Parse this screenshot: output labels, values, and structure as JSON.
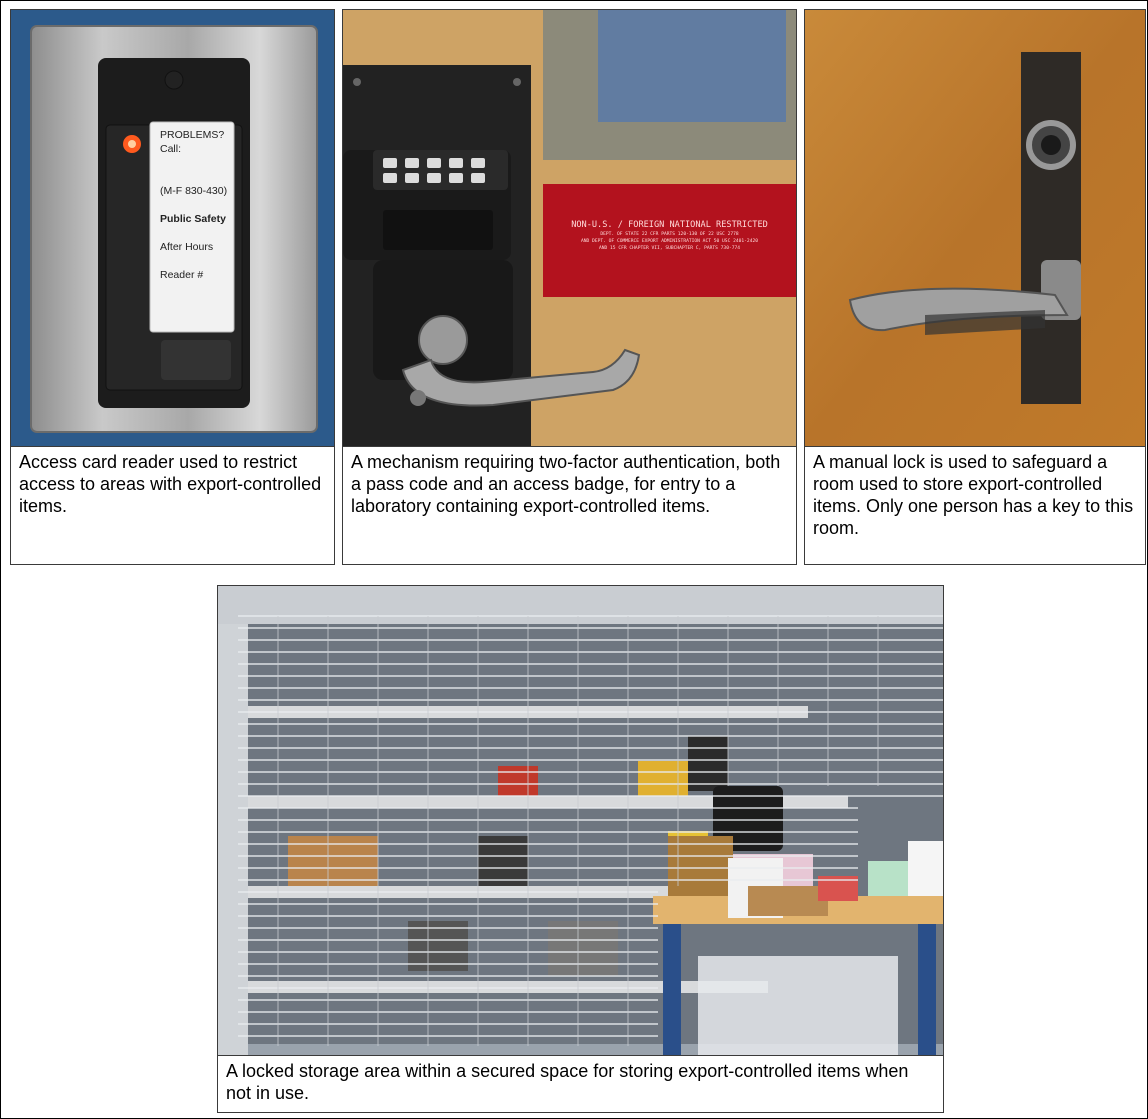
{
  "panels": [
    {
      "caption": "Access card reader used to restrict access to areas with export-controlled items.",
      "sticker": {
        "line1": "PROBLEMS?",
        "line2": "Call:",
        "hours": "(M-F 830-430)",
        "dept": "Public Safety",
        "after": "After Hours",
        "reader": "Reader #"
      }
    },
    {
      "caption": "A mechanism requiring two-factor authentication, both a pass code and an access badge, for entry to a laboratory containing export-controlled items.",
      "sign": {
        "title": "NON-U.S. / FOREIGN NATIONAL RESTRICTED",
        "line1": "DEPT. OF STATE 22 CFR PARTS 120-130 OF 22 USC 2778",
        "line2": "AND DEPT. OF COMMERCE EXPORT ADMINISTRATION ACT 50 USC 2401-2420",
        "line3": "AND 15 CFR CHAPTER VII, SUBCHAPTER C, PARTS 730-774"
      }
    },
    {
      "caption": "A manual lock is used to safeguard a room used to store export-controlled items. Only one person has a key to this room."
    },
    {
      "caption": "A locked storage area within a secured space for storing export-controlled items when not in use."
    }
  ],
  "colors": {
    "wall_blue": "#2f5f92",
    "door_wood": "#c89a58",
    "door_orange": "#c07a2a",
    "sign_red": "#b3121e",
    "reader_black": "#1c1c1c"
  }
}
